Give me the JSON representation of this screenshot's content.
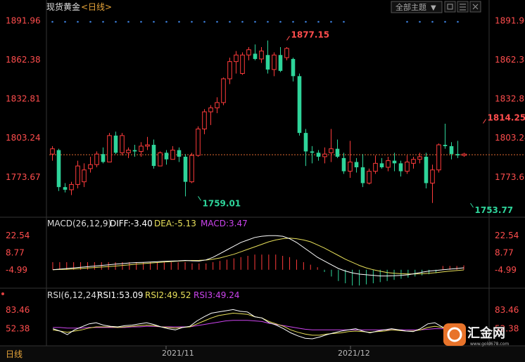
{
  "header": {
    "title": "现货黄金",
    "period": "<日线>",
    "theme_button": "全部主题",
    "theme_arrow": "▼"
  },
  "macd_header": {
    "name": "MACD(26,12,9)",
    "diff": "DIFF:-3.40",
    "dea": "DEA:-5.13",
    "macd": "MACD:3.47"
  },
  "rsi_header": {
    "name": "RSI(6,12,24)",
    "rsi1": "RSI1:53.09",
    "rsi2": "RSI2:49.52",
    "rsi3": "RSI3:49.24"
  },
  "bottom": {
    "period_label": "日线",
    "dates": [
      "2021/11",
      "2021/12"
    ]
  },
  "logo": {
    "name": "汇金网",
    "url": "www.gold678.com"
  },
  "colors": {
    "up": "#ff3b3b",
    "down": "#2ed49a",
    "axis_price": "#ff4d4d",
    "diff_line": "#ffffff",
    "dea_line": "#e8e05a",
    "macd_text": "#cc44ee",
    "rsi1": "#ffffff",
    "rsi2": "#e8e05a",
    "rsi3": "#cc44ee",
    "dotted": "#3a7bd5"
  },
  "chart_data": [
    {
      "type": "candlestick",
      "title": "现货黄金 <日线>",
      "y_ticks": [
        "1891.96",
        "1862.38",
        "1832.81",
        "1803.24",
        "1773.67"
      ],
      "ylim": [
        1748,
        1897
      ],
      "annotations": [
        {
          "label": "1877.15",
          "value": 1877.15,
          "candle_index": 37,
          "color": "#ff4d4d"
        },
        {
          "label": "1759.01",
          "value": 1759.01,
          "candle_index": 23,
          "color": "#2ed49a"
        },
        {
          "label": "1753.77",
          "value": 1753.77,
          "candle_index": 66,
          "color": "#2ed49a"
        },
        {
          "label": "1814.25",
          "value": 1814.25,
          "candle_index": 68,
          "color": "#ff4d4d"
        }
      ],
      "reference_line": 1790.5,
      "candles": [
        {
          "o": 1791,
          "h": 1797,
          "l": 1786,
          "c": 1795
        },
        {
          "o": 1794,
          "h": 1795,
          "l": 1763,
          "c": 1766
        },
        {
          "o": 1766,
          "h": 1769,
          "l": 1762,
          "c": 1764
        },
        {
          "o": 1764,
          "h": 1770,
          "l": 1760,
          "c": 1768
        },
        {
          "o": 1768,
          "h": 1786,
          "l": 1765,
          "c": 1782
        },
        {
          "o": 1770,
          "h": 1784,
          "l": 1766,
          "c": 1779
        },
        {
          "o": 1780,
          "h": 1789,
          "l": 1777,
          "c": 1783
        },
        {
          "o": 1783,
          "h": 1793,
          "l": 1781,
          "c": 1791
        },
        {
          "o": 1791,
          "h": 1796,
          "l": 1784,
          "c": 1785
        },
        {
          "o": 1785,
          "h": 1807,
          "l": 1785,
          "c": 1805
        },
        {
          "o": 1805,
          "h": 1808,
          "l": 1791,
          "c": 1792
        },
        {
          "o": 1792,
          "h": 1807,
          "l": 1790,
          "c": 1805
        },
        {
          "o": 1792,
          "h": 1796,
          "l": 1788,
          "c": 1794
        },
        {
          "o": 1794,
          "h": 1798,
          "l": 1789,
          "c": 1793
        },
        {
          "o": 1793,
          "h": 1800,
          "l": 1789,
          "c": 1797
        },
        {
          "o": 1797,
          "h": 1804,
          "l": 1794,
          "c": 1798
        },
        {
          "o": 1798,
          "h": 1802,
          "l": 1780,
          "c": 1782
        },
        {
          "o": 1782,
          "h": 1793,
          "l": 1782,
          "c": 1792
        },
        {
          "o": 1792,
          "h": 1794,
          "l": 1783,
          "c": 1787
        },
        {
          "o": 1787,
          "h": 1797,
          "l": 1787,
          "c": 1794
        },
        {
          "o": 1794,
          "h": 1796,
          "l": 1785,
          "c": 1789
        },
        {
          "o": 1789,
          "h": 1791,
          "l": 1759,
          "c": 1770
        },
        {
          "o": 1770,
          "h": 1792,
          "l": 1769,
          "c": 1790
        },
        {
          "o": 1790,
          "h": 1812,
          "l": 1789,
          "c": 1810
        },
        {
          "o": 1810,
          "h": 1825,
          "l": 1806,
          "c": 1823
        },
        {
          "o": 1823,
          "h": 1828,
          "l": 1813,
          "c": 1826
        },
        {
          "o": 1826,
          "h": 1834,
          "l": 1822,
          "c": 1830
        },
        {
          "o": 1830,
          "h": 1849,
          "l": 1828,
          "c": 1848
        },
        {
          "o": 1848,
          "h": 1864,
          "l": 1844,
          "c": 1861
        },
        {
          "o": 1861,
          "h": 1869,
          "l": 1852,
          "c": 1866
        },
        {
          "o": 1852,
          "h": 1868,
          "l": 1851,
          "c": 1866
        },
        {
          "o": 1866,
          "h": 1872,
          "l": 1862,
          "c": 1870
        },
        {
          "o": 1867,
          "h": 1874,
          "l": 1862,
          "c": 1863
        },
        {
          "o": 1863,
          "h": 1872,
          "l": 1860,
          "c": 1869
        },
        {
          "o": 1866,
          "h": 1877,
          "l": 1852,
          "c": 1855
        },
        {
          "o": 1855,
          "h": 1868,
          "l": 1850,
          "c": 1866
        },
        {
          "o": 1866,
          "h": 1872,
          "l": 1853,
          "c": 1854
        },
        {
          "o": 1864,
          "h": 1872,
          "l": 1862,
          "c": 1871
        },
        {
          "o": 1863,
          "h": 1864,
          "l": 1846,
          "c": 1850
        },
        {
          "o": 1850,
          "h": 1852,
          "l": 1805,
          "c": 1807
        },
        {
          "o": 1807,
          "h": 1810,
          "l": 1782,
          "c": 1793
        },
        {
          "o": 1793,
          "h": 1797,
          "l": 1784,
          "c": 1792
        },
        {
          "o": 1792,
          "h": 1794,
          "l": 1786,
          "c": 1789
        },
        {
          "o": 1789,
          "h": 1796,
          "l": 1784,
          "c": 1791
        },
        {
          "o": 1792,
          "h": 1810,
          "l": 1785,
          "c": 1795
        },
        {
          "o": 1795,
          "h": 1802,
          "l": 1788,
          "c": 1789
        },
        {
          "o": 1788,
          "h": 1792,
          "l": 1776,
          "c": 1778
        },
        {
          "o": 1778,
          "h": 1801,
          "l": 1773,
          "c": 1785
        },
        {
          "o": 1785,
          "h": 1788,
          "l": 1777,
          "c": 1781
        },
        {
          "o": 1781,
          "h": 1791,
          "l": 1766,
          "c": 1769
        },
        {
          "o": 1769,
          "h": 1780,
          "l": 1768,
          "c": 1778
        },
        {
          "o": 1778,
          "h": 1790,
          "l": 1776,
          "c": 1784
        },
        {
          "o": 1784,
          "h": 1788,
          "l": 1780,
          "c": 1781
        },
        {
          "o": 1781,
          "h": 1789,
          "l": 1778,
          "c": 1786
        },
        {
          "o": 1786,
          "h": 1792,
          "l": 1778,
          "c": 1784
        },
        {
          "o": 1784,
          "h": 1786,
          "l": 1774,
          "c": 1778
        },
        {
          "o": 1778,
          "h": 1790,
          "l": 1776,
          "c": 1785
        },
        {
          "o": 1784,
          "h": 1789,
          "l": 1780,
          "c": 1787
        },
        {
          "o": 1787,
          "h": 1792,
          "l": 1784,
          "c": 1789
        },
        {
          "o": 1789,
          "h": 1792,
          "l": 1765,
          "c": 1769
        },
        {
          "o": 1769,
          "h": 1783,
          "l": 1754,
          "c": 1779
        },
        {
          "o": 1779,
          "h": 1799,
          "l": 1777,
          "c": 1798
        },
        {
          "o": 1798,
          "h": 1814,
          "l": 1795,
          "c": 1797
        },
        {
          "o": 1797,
          "h": 1800,
          "l": 1787,
          "c": 1791
        },
        {
          "o": 1791,
          "h": 1801,
          "l": 1788,
          "c": 1790
        },
        {
          "o": 1790,
          "h": 1792,
          "l": 1789,
          "c": 1791
        }
      ]
    },
    {
      "type": "macd",
      "y_ticks": [
        "22.54",
        "8.77",
        "-4.99"
      ],
      "ylim": [
        -17,
        26
      ],
      "diff": [
        -5,
        -4.5,
        -4,
        -3.5,
        -3,
        -2.5,
        -2,
        -1.5,
        -1,
        -0.5,
        0,
        0.5,
        0.8,
        1,
        1.2,
        1.5,
        1.8,
        2,
        2.2,
        2.5,
        2.2,
        2,
        3,
        5,
        8,
        11,
        14,
        17,
        19,
        21,
        22,
        22.5,
        22.5,
        22,
        20,
        17,
        13,
        9,
        5,
        2,
        -1,
        -4,
        -6,
        -7.5,
        -8.5,
        -9,
        -9.5,
        -10,
        -10,
        -9.8,
        -9.5,
        -9,
        -8,
        -7,
        -6,
        -5.5,
        -5,
        -4.5,
        -4,
        -3.4
      ],
      "dea": [
        -5,
        -4.8,
        -4.6,
        -4.3,
        -4,
        -3.6,
        -3.2,
        -2.8,
        -2.4,
        -2,
        -1.5,
        -1,
        -0.5,
        0,
        0.4,
        0.8,
        1.2,
        1.6,
        2,
        2.3,
        2.5,
        2.6,
        2.8,
        3.5,
        4.5,
        6,
        7.5,
        9.5,
        11.5,
        13.5,
        15.5,
        17.5,
        19,
        20,
        20.5,
        20,
        19,
        17.5,
        15,
        12.5,
        9.5,
        6.5,
        3.5,
        1,
        -1.5,
        -3.5,
        -5,
        -6.2,
        -7.2,
        -7.8,
        -8.2,
        -8.4,
        -8.4,
        -8.2,
        -7.8,
        -7.3,
        -6.7,
        -6.1,
        -5.6,
        -5.13
      ],
      "macd": [
        6,
        6,
        6,
        6,
        6,
        6,
        6,
        6,
        6,
        6,
        6,
        6,
        6,
        6,
        6,
        6,
        6,
        6,
        6,
        6,
        5,
        5,
        5,
        6,
        7,
        8,
        9,
        10,
        11,
        12,
        12,
        12,
        12,
        11,
        10,
        8,
        6,
        4,
        2,
        -2,
        -6,
        -10,
        -12,
        -14,
        -14,
        -13,
        -12,
        -11,
        -10,
        -9,
        -8,
        -7,
        -6,
        -5,
        -4,
        -3,
        3,
        3,
        3,
        3.47
      ]
    },
    {
      "type": "rsi",
      "y_ticks": [
        "83.46",
        "52.38"
      ],
      "ylim": [
        28,
        95
      ],
      "rsi1": [
        52,
        48,
        42,
        50,
        55,
        60,
        62,
        58,
        56,
        55,
        57,
        58,
        60,
        62,
        59,
        55,
        52,
        50,
        54,
        56,
        65,
        72,
        78,
        80,
        82,
        84,
        81,
        80,
        72,
        70,
        62,
        58,
        52,
        45,
        40,
        36,
        35,
        38,
        42,
        45,
        48,
        50,
        52,
        48,
        45,
        48,
        50,
        52,
        50,
        48,
        47,
        52,
        60,
        62,
        55,
        50,
        48,
        53
      ],
      "rsi2": [
        50,
        48,
        46,
        48,
        50,
        53,
        55,
        55,
        55,
        54,
        55,
        56,
        57,
        58,
        57,
        55,
        54,
        53,
        54,
        55,
        60,
        65,
        70,
        74,
        76,
        78,
        77,
        76,
        72,
        70,
        64,
        60,
        56,
        50,
        46,
        43,
        41,
        41,
        43,
        44,
        45,
        47,
        48,
        47,
        46,
        47,
        48,
        50,
        49,
        48,
        48,
        50,
        54,
        56,
        54,
        51,
        50,
        49.52
      ],
      "rsi3": [
        54,
        54,
        53,
        53,
        53,
        54,
        54,
        54,
        54,
        54,
        54,
        55,
        55,
        56,
        56,
        55,
        55,
        55,
        55,
        55,
        57,
        59,
        61,
        63,
        65,
        66,
        66,
        66,
        65,
        64,
        61,
        59,
        57,
        55,
        53,
        51,
        50,
        50,
        50,
        50,
        50,
        50,
        50,
        50,
        50,
        50,
        50,
        50,
        50,
        50,
        50,
        50,
        51,
        52,
        52,
        51,
        50,
        49.24
      ]
    }
  ]
}
